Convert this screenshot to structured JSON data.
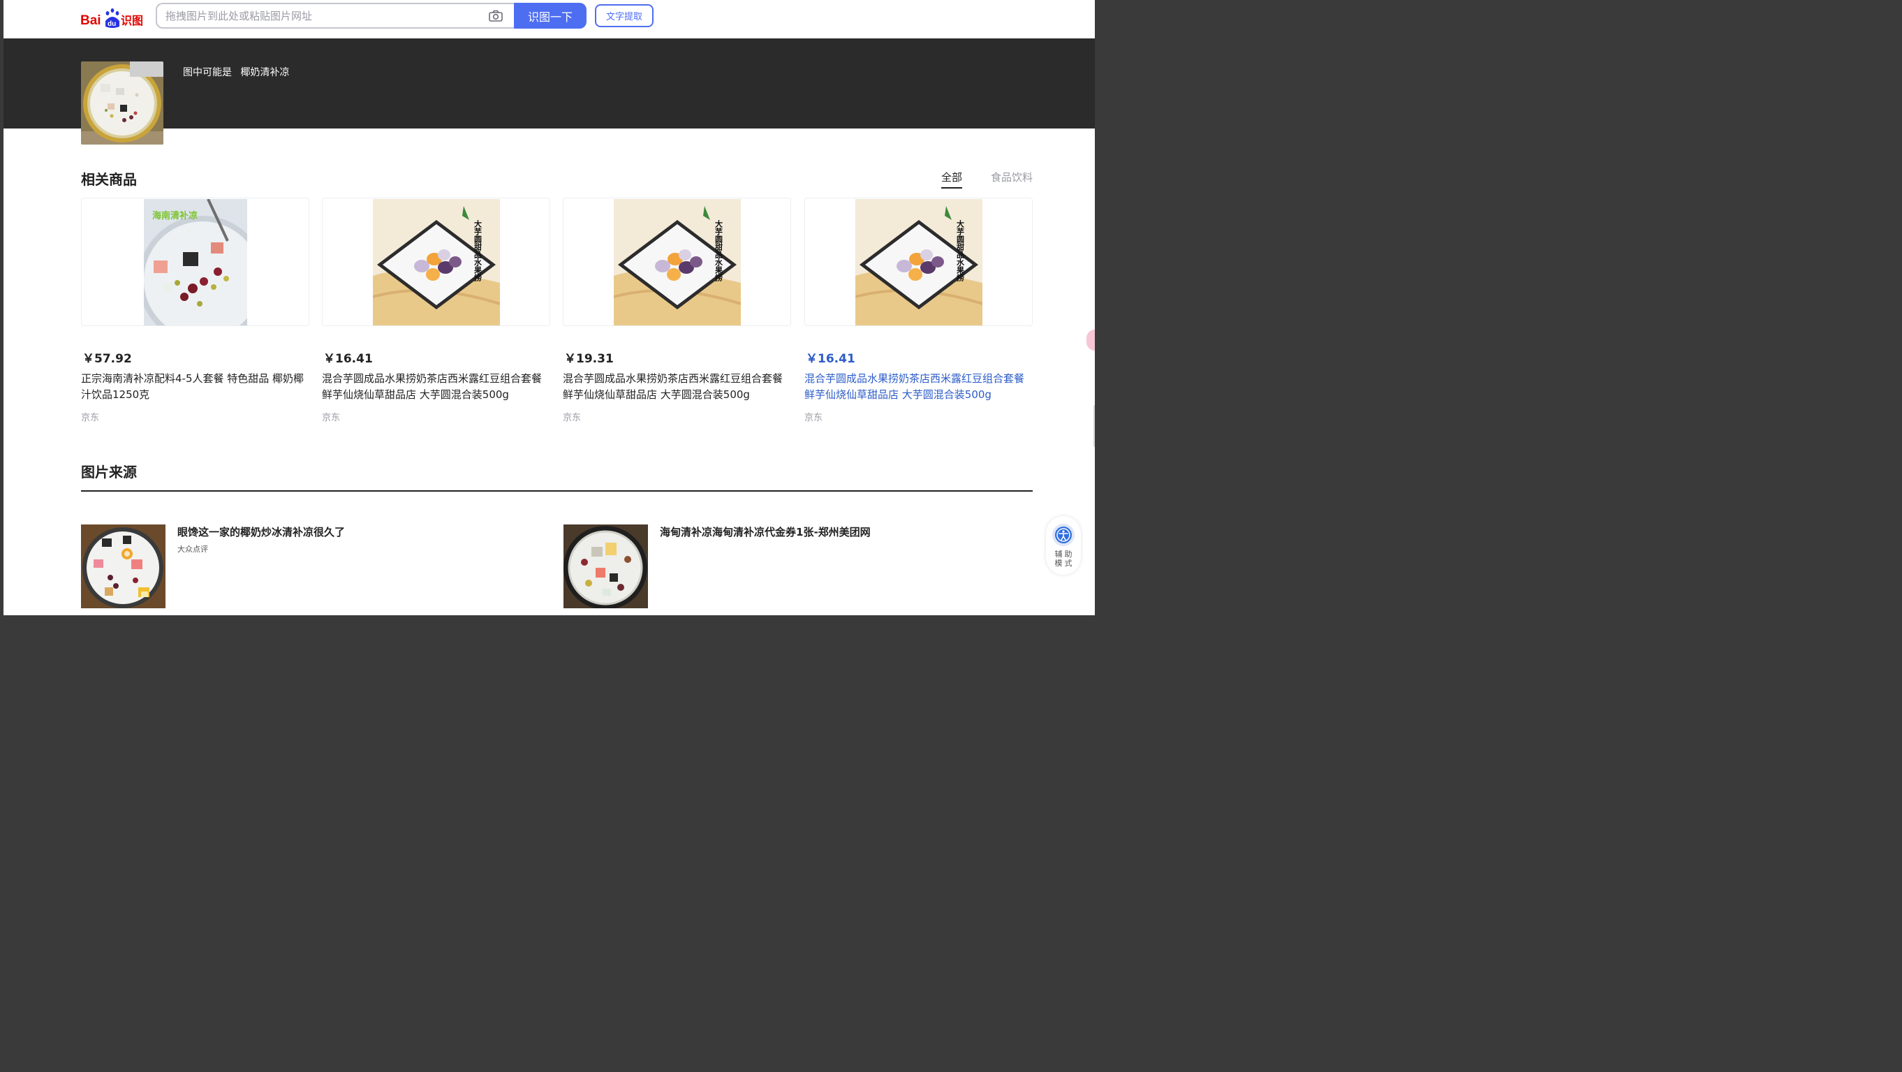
{
  "header": {
    "logo_text": "Baidu识图",
    "search_placeholder": "拖拽图片到此处或粘贴图片网址",
    "search_value": "",
    "search_button": "识图一下",
    "ocr_button": "文字提取"
  },
  "banner": {
    "guess_prefix": "图中可能是",
    "guess_value": "椰奶清补凉"
  },
  "products_section": {
    "title": "相关商品",
    "tabs": [
      {
        "label": "全部",
        "active": true
      },
      {
        "label": "食品饮料",
        "active": false
      }
    ],
    "items": [
      {
        "price": "￥57.92",
        "title": "正宗海南清补凉配料4-5人套餐 特色甜品 椰奶椰汁饮品1250克",
        "shop": "京东",
        "image_caption": "海南清补凉"
      },
      {
        "price": "￥16.41",
        "title": "混合芋圆成品水果捞奶茶店西米露红豆组合套餐鲜芋仙烧仙草甜品店 大芋圆混合装500g",
        "shop": "京东",
        "image_caption": "大芋圆甜品水果捞"
      },
      {
        "price": "￥19.31",
        "title": "混合芋圆成品水果捞奶茶店西米露红豆组合套餐鲜芋仙烧仙草甜品店 大芋圆混合装500g",
        "shop": "京东",
        "image_caption": "大芋圆甜品水果捞"
      },
      {
        "price": "￥16.41",
        "title": "混合芋圆成品水果捞奶茶店西米露红豆组合套餐鲜芋仙烧仙草甜品店 大芋圆混合装500g",
        "shop": "京东",
        "image_caption": "大芋圆甜品水果捞"
      }
    ]
  },
  "sources_section": {
    "title": "图片来源",
    "items": [
      {
        "title": "眼馋这一家的椰奶炒冰清补凉很久了",
        "site": "大众点评"
      },
      {
        "title": "海甸清补凉海甸清补凉代金券1张-郑州美团网",
        "site": ""
      }
    ]
  },
  "assist": {
    "label_line1": "辅助",
    "label_line2": "模式"
  },
  "colors": {
    "accent": "#4e6ef2",
    "banner_bg": "#2b2b2b",
    "hover_link": "#2c5cc8"
  }
}
